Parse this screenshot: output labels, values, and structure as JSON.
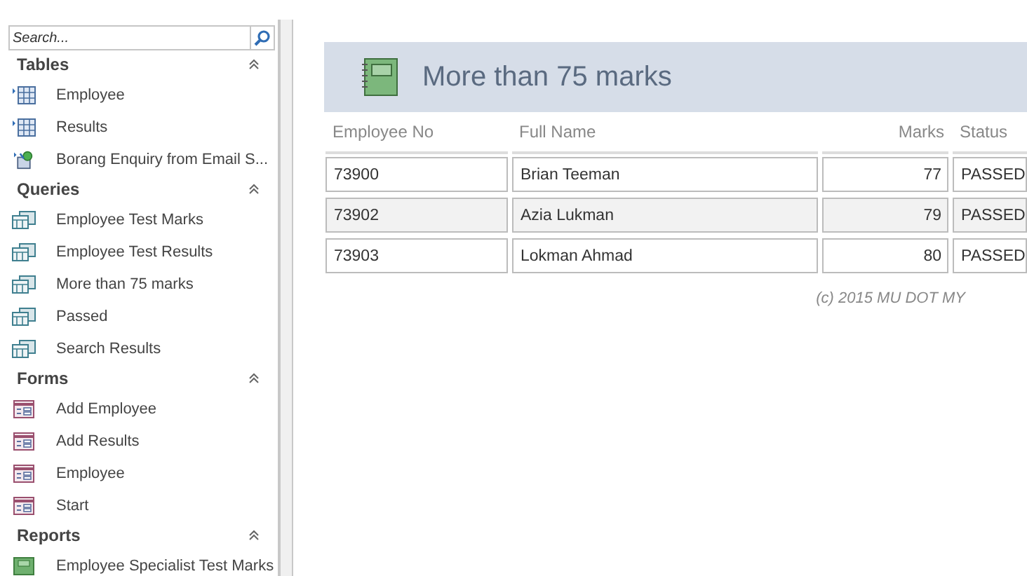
{
  "search": {
    "placeholder": "Search..."
  },
  "groups": [
    {
      "label": "Tables",
      "expanded": true,
      "items": [
        {
          "label": "Employee",
          "kind": "table"
        },
        {
          "label": "Results",
          "kind": "table"
        },
        {
          "label": "Borang Enquiry from Email S...",
          "kind": "linked"
        }
      ]
    },
    {
      "label": "Queries",
      "expanded": true,
      "items": [
        {
          "label": "Employee Test Marks",
          "kind": "query"
        },
        {
          "label": "Employee Test Results",
          "kind": "query"
        },
        {
          "label": "More than 75 marks",
          "kind": "query"
        },
        {
          "label": "Passed",
          "kind": "query"
        },
        {
          "label": "Search Results",
          "kind": "query"
        }
      ]
    },
    {
      "label": "Forms",
      "expanded": true,
      "items": [
        {
          "label": "Add Employee",
          "kind": "form"
        },
        {
          "label": "Add Results",
          "kind": "form"
        },
        {
          "label": "Employee",
          "kind": "form"
        },
        {
          "label": "Start",
          "kind": "form"
        }
      ]
    },
    {
      "label": "Reports",
      "expanded": true,
      "items": [
        {
          "label": "Employee Specialist Test Marks",
          "kind": "report"
        }
      ]
    }
  ],
  "report": {
    "title": "More than 75 marks",
    "columns": [
      "Employee No",
      "Full Name",
      "Marks",
      "Status"
    ],
    "rows": [
      [
        "73900",
        "Brian Teeman",
        "77",
        "PASSED"
      ],
      [
        "73902",
        "Azia Lukman",
        "79",
        "PASSED"
      ],
      [
        "73903",
        "Lokman Ahmad",
        "80",
        "PASSED"
      ]
    ],
    "footer": "(c) 2015 MU DOT MY"
  }
}
